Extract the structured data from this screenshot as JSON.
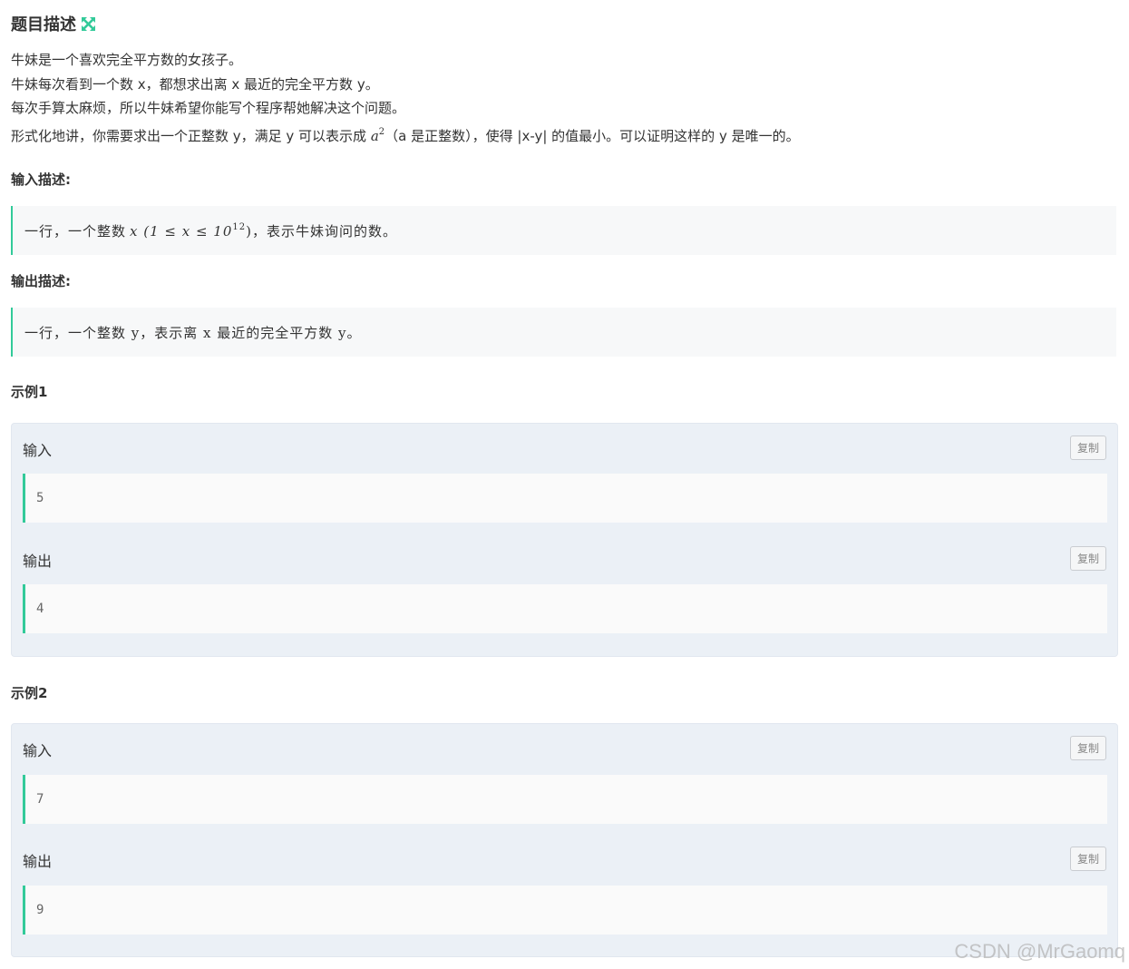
{
  "problem": {
    "title": "题目描述",
    "description": [
      "牛妹是一个喜欢完全平方数的女孩子。",
      "牛妹每次看到一个数 x，都想求出离 x 最近的完全平方数 y。",
      "每次手算太麻烦，所以牛妹希望你能写个程序帮她解决这个问题。"
    ],
    "formal_prefix": "形式化地讲，你需要求出一个正整数 y，满足 y 可以表示成 ",
    "formal_math": "a",
    "formal_sup": "2",
    "formal_suffix": "（a 是正整数），使得 |x-y| 的值最小。可以证明这样的 y 是唯一的。"
  },
  "input": {
    "label": "输入描述:",
    "text_prefix": "一行，一个整数 ",
    "math": "x (1 ≤ x ≤ 10",
    "math_sup": "12",
    "math_close": ")",
    "text_suffix": "，表示牛妹询问的数。"
  },
  "output": {
    "label": "输出描述:",
    "text": "一行，一个整数 y，表示离 x 最近的完全平方数 y。"
  },
  "examples": [
    {
      "title": "示例1",
      "input_label": "输入",
      "input_value": "5",
      "output_label": "输出",
      "output_value": "4",
      "copy_label": "复制"
    },
    {
      "title": "示例2",
      "input_label": "输入",
      "input_value": "7",
      "output_label": "输出",
      "output_value": "9",
      "copy_label": "复制"
    }
  ],
  "watermark": "CSDN @MrGaomq",
  "colors": {
    "accent": "#32ca99",
    "example_bg": "#ebf0f6"
  },
  "icons": {
    "expand": "expand-arrows-icon"
  }
}
